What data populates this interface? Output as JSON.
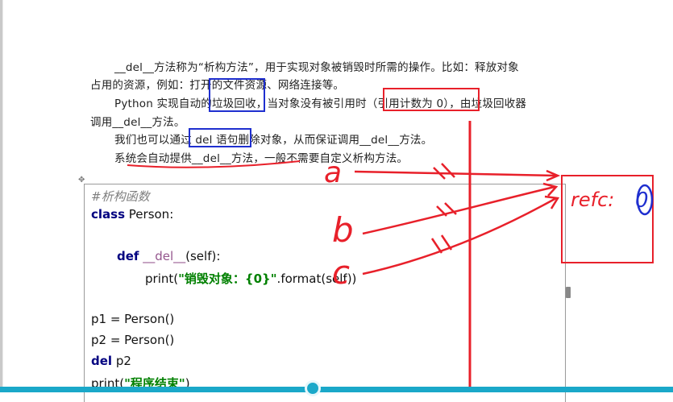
{
  "document": {
    "paragraphs": [
      "__del__方法称为“析构方法”，用于实现对象被销毁时所需的操作。比如：释放对象",
      "占用的资源，例如：打开的文件资源、网络连接等。",
      "Python 实现自动的垃圾回收，当对象没有被引用时（引用计数为 0），由垃圾回收器",
      "调用__del__方法。",
      "我们也可以通过 del 语句删除对象，从而保证调用__del__方法。",
      "系统会自动提供__del__方法，一般不需要自定义析构方法。"
    ]
  },
  "code": {
    "comment": "#析构函数",
    "class_kw": "class",
    "class_name": " Person:",
    "def_kw": "def",
    "method_name": "__del__",
    "method_params": "(self):",
    "print_fn": "print(",
    "print_str": "\"销毁对象：{0}\"",
    "print_rest": ".format(self))",
    "line_p1": "p1 = Person()",
    "line_p2": "p2 = Person()",
    "del_kw": "del",
    "del_target": " p2",
    "print2_fn": "print(",
    "print2_str": "\"程序结束\"",
    "print2_rest": ")"
  },
  "annotations": {
    "label_a": "a",
    "label_b": "b",
    "label_c": "c",
    "refc_text": "refc:",
    "refc_value": "0"
  },
  "colors": {
    "annotation_red": "#e8202a",
    "box_blue": "#1f2fcf",
    "accent_teal": "#1aa8c9"
  }
}
